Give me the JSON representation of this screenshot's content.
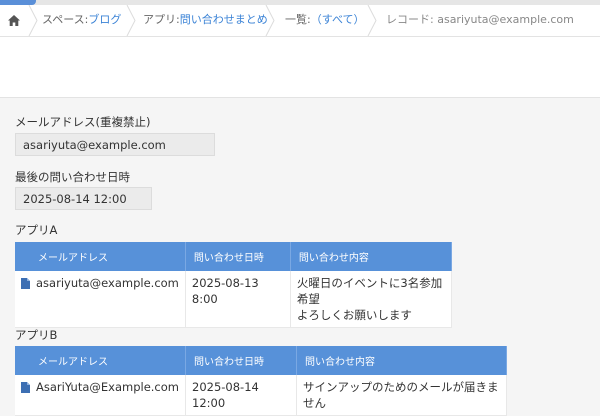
{
  "breadcrumb": {
    "home_icon": "home-icon",
    "space_label": "スペース:",
    "space_value": "ブログ",
    "app_label": "アプリ:",
    "app_value": "問い合わせまとめ",
    "list_label": "一覧:",
    "list_value": "（すべて）",
    "record_label": "レコード:",
    "record_value": "asariyuta@example.com"
  },
  "fields": {
    "email_label": "メールアドレス(重複禁止)",
    "email_value": "asariyuta@example.com",
    "last_inquiry_label": "最後の問い合わせ日時",
    "last_inquiry_value": "2025-08-14 12:00"
  },
  "app_a": {
    "title": "アプリA",
    "headers": [
      "メールアドレス",
      "問い合わせ日時",
      "問い合わせ内容"
    ],
    "rows": [
      {
        "email": "asariyuta@example.com",
        "datetime": "2025-08-13 8:00",
        "content_line1": "火曜日のイベントに3名参加希望",
        "content_line2": "よろしくお願いします"
      }
    ]
  },
  "app_b": {
    "title": "アプリB",
    "headers": [
      "メールアドレス",
      "問い合わせ日時",
      "問い合わせ内容"
    ],
    "rows": [
      {
        "email": "AsariYuta@Example.com",
        "datetime": "2025-08-14 12:00",
        "content_line1": "サインアップのためのメールが届きません"
      }
    ]
  },
  "colors": {
    "header_blue": "#5791d9",
    "link_blue": "#3b83d6"
  }
}
